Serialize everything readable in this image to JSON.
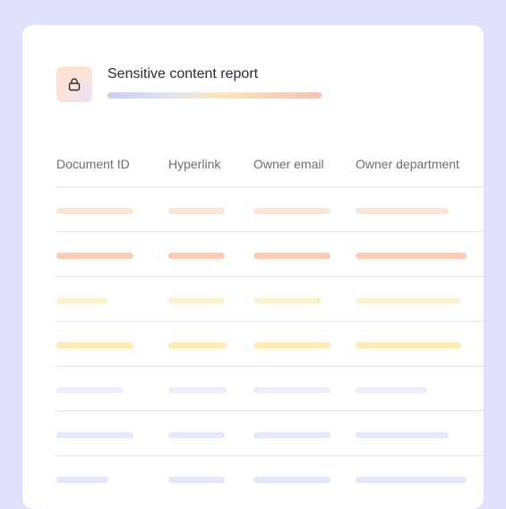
{
  "report": {
    "title": "Sensitive content report",
    "icon": "lock-icon"
  },
  "table": {
    "columns": [
      "Document ID",
      "Hyperlink",
      "Owner email",
      "Owner department"
    ],
    "rows": [
      {
        "color": "#fbe5d8"
      },
      {
        "color": "#f9cbb8"
      },
      {
        "color": "#fbf2cf"
      },
      {
        "color": "#fdebb6"
      },
      {
        "color": "#eceefb"
      },
      {
        "color": "#e5e7fa"
      },
      {
        "color": "#e3e5f8"
      }
    ]
  },
  "colors": {
    "page_background": "#e2e1fc",
    "card_background": "#ffffff",
    "title_text": "#2a2a35",
    "header_text": "#6b6b78",
    "divider": "#e3e3ea"
  }
}
